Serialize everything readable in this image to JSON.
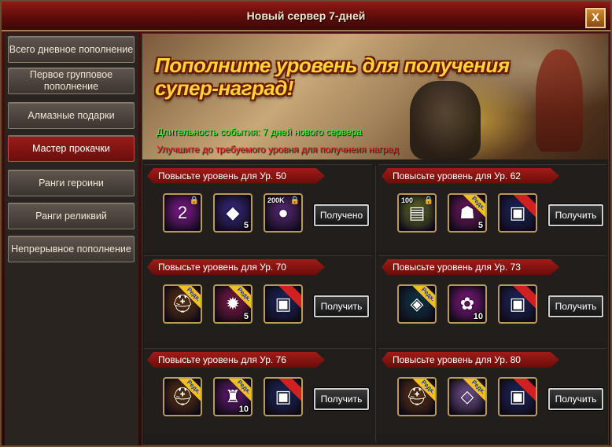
{
  "window": {
    "title": "Новый сервер 7-дней",
    "close_label": "X"
  },
  "sidebar": {
    "items": [
      {
        "label": "Всего дневное пополнение",
        "active": false
      },
      {
        "label": "Первое групповое пополнение",
        "active": false
      },
      {
        "label": "Алмазные подарки",
        "active": false
      },
      {
        "label": "Мастер прокачки",
        "active": true
      },
      {
        "label": "Ранги героини",
        "active": false
      },
      {
        "label": "Ранги реликвий",
        "active": false
      },
      {
        "label": "Непрерывное пополнение",
        "active": false
      }
    ]
  },
  "banner": {
    "headline": "Пополните уровень для получения супер-наград!",
    "duration": "Длительность события: 7 дней нового сервера",
    "hint": "Улучшите до требуемого уровня для получнеия наград"
  },
  "tasks": [
    {
      "title": "Повысьте уровень для Ур. 50",
      "button": "Получено",
      "items": [
        {
          "icon": "purple-orb-icon",
          "count": "",
          "corner": "",
          "ribbon": "",
          "lock": true,
          "color": "#8a1a9a",
          "glyph": "2"
        },
        {
          "icon": "crystal-chest-icon",
          "count": "5",
          "corner": "",
          "ribbon": "",
          "lock": false,
          "color": "#3a2a8a",
          "glyph": "◆"
        },
        {
          "icon": "silver-coins-icon",
          "count": "",
          "corner": "200K",
          "ribbon": "",
          "lock": true,
          "color": "#5a2a7a",
          "glyph": "●"
        }
      ]
    },
    {
      "title": "Повысьте уровень для Ур. 62",
      "button": "Получить",
      "items": [
        {
          "icon": "money-stack-icon",
          "count": "",
          "corner": "100",
          "ribbon": "",
          "lock": true,
          "color": "#6a7a2a",
          "glyph": "▤"
        },
        {
          "icon": "beast-portrait-icon",
          "count": "5",
          "corner": "",
          "ribbon": "Редк.",
          "lock": false,
          "color": "#7a1a6a",
          "glyph": "☗"
        },
        {
          "icon": "blue-card-icon",
          "count": "",
          "corner": "",
          "ribbon": "",
          "lock": false,
          "color": "#1a2a6a",
          "glyph": "▣"
        }
      ]
    },
    {
      "title": "Повысьте уровень для Ур. 70",
      "button": "Получить",
      "items": [
        {
          "icon": "helmet-icon",
          "count": "",
          "corner": "",
          "ribbon": "Редк.",
          "lock": false,
          "color": "#6a3a10",
          "glyph": "⛑"
        },
        {
          "icon": "red-emblem-icon",
          "count": "5",
          "corner": "",
          "ribbon": "Редк.",
          "lock": false,
          "color": "#8a1a4a",
          "glyph": "✹"
        },
        {
          "icon": "blue-card-icon",
          "count": "",
          "corner": "",
          "ribbon": "",
          "lock": false,
          "color": "#1a2a6a",
          "glyph": "▣"
        }
      ]
    },
    {
      "title": "Повысьте уровень для Ур. 73",
      "button": "Получить",
      "items": [
        {
          "icon": "green-gem-icon",
          "count": "",
          "corner": "",
          "ribbon": "Редк.",
          "lock": false,
          "color": "#0a3a4a",
          "glyph": "◈"
        },
        {
          "icon": "rose-icon",
          "count": "10",
          "corner": "",
          "ribbon": "",
          "lock": false,
          "color": "#8a1a8a",
          "glyph": "✿"
        },
        {
          "icon": "blue-card-icon",
          "count": "",
          "corner": "",
          "ribbon": "",
          "lock": false,
          "color": "#1a2a6a",
          "glyph": "▣"
        }
      ]
    },
    {
      "title": "Повысьте уровень для Ур. 76",
      "button": "Получить",
      "items": [
        {
          "icon": "helmet-icon",
          "count": "",
          "corner": "",
          "ribbon": "Редк.",
          "lock": false,
          "color": "#6a3a10",
          "glyph": "⛑"
        },
        {
          "icon": "armor-icon",
          "count": "10",
          "corner": "",
          "ribbon": "Редк.",
          "lock": false,
          "color": "#6a1a7a",
          "glyph": "♜"
        },
        {
          "icon": "blue-card-icon",
          "count": "",
          "corner": "",
          "ribbon": "",
          "lock": false,
          "color": "#1a2a6a",
          "glyph": "▣"
        }
      ]
    },
    {
      "title": "Повысьте уровень для Ур. 80",
      "button": "Получить",
      "items": [
        {
          "icon": "helmet-icon",
          "count": "",
          "corner": "",
          "ribbon": "Редк.",
          "lock": false,
          "color": "#6a3a10",
          "glyph": "⛑"
        },
        {
          "icon": "lavender-crystal-icon",
          "count": "",
          "corner": "",
          "ribbon": "Редк.",
          "lock": false,
          "color": "#7a5a9a",
          "glyph": "◇"
        },
        {
          "icon": "blue-card-icon",
          "count": "",
          "corner": "",
          "ribbon": "",
          "lock": false,
          "color": "#1a2a6a",
          "glyph": "▣"
        }
      ]
    }
  ]
}
